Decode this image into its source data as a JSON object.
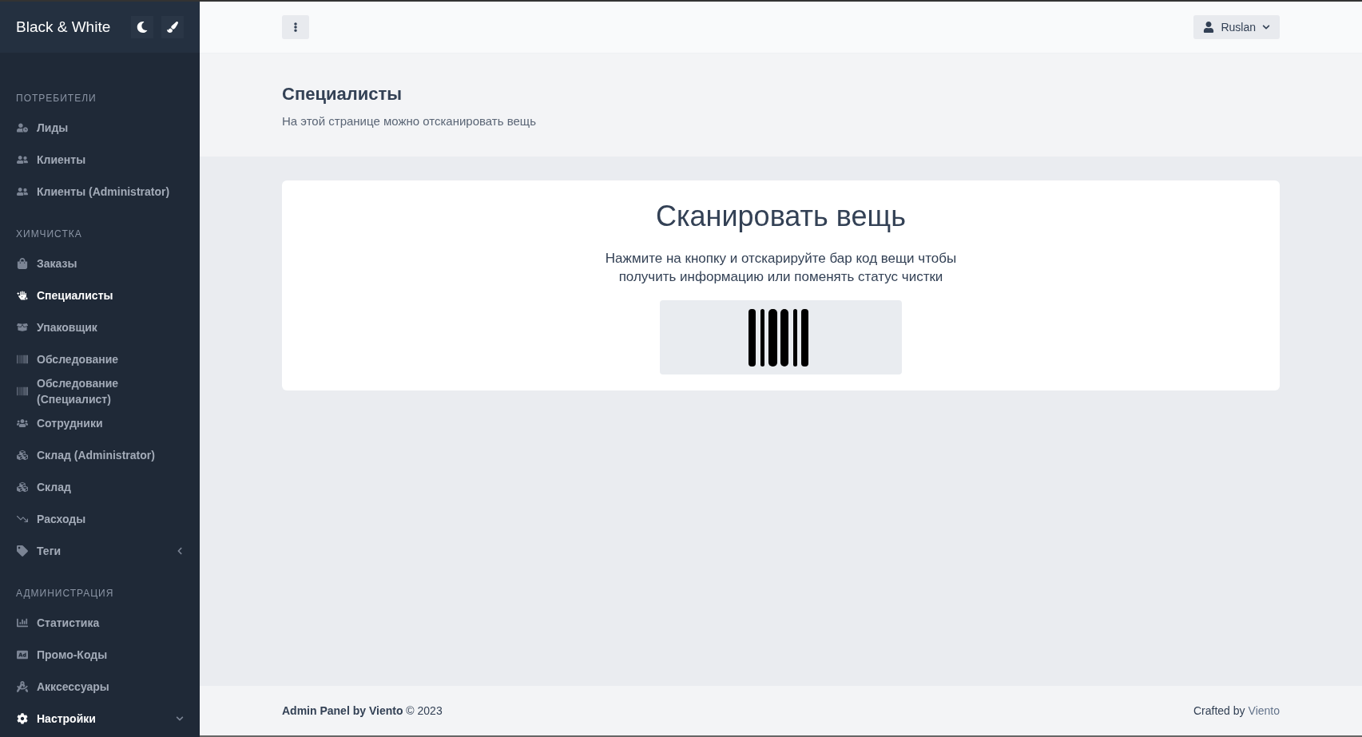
{
  "sidebar": {
    "brand": "Black & White",
    "sections": [
      {
        "title": "ПОТРЕБИТЕЛИ",
        "items": [
          {
            "label": "Лиды",
            "selected": false
          },
          {
            "label": "Клиенты",
            "selected": false
          },
          {
            "label": "Клиенты (Administrator)",
            "selected": false
          }
        ]
      },
      {
        "title": "ХИМЧИСТКА",
        "items": [
          {
            "label": "Заказы",
            "selected": false
          },
          {
            "label": "Специалисты",
            "selected": true
          },
          {
            "label": "Упаковщик",
            "selected": false
          },
          {
            "label": "Обследование",
            "selected": false
          },
          {
            "label": "Обследование (Специалист)",
            "selected": false
          },
          {
            "label": "Сотрудники",
            "selected": false
          },
          {
            "label": "Склад (Administrator)",
            "selected": false
          },
          {
            "label": "Склад",
            "selected": false
          },
          {
            "label": "Расходы",
            "selected": false
          },
          {
            "label": "Теги",
            "selected": false,
            "expanded": false
          }
        ]
      },
      {
        "title": "АДМИНИСТРАЦИЯ",
        "items": [
          {
            "label": "Статистика",
            "selected": false
          },
          {
            "label": "Промо-Коды",
            "selected": false
          },
          {
            "label": "Акксессуары",
            "selected": false
          },
          {
            "label": "Настройки",
            "selected": true,
            "expanded": true
          }
        ]
      }
    ]
  },
  "header": {
    "user": "Ruslan"
  },
  "page": {
    "title": "Специалисты",
    "subtitle": "На этой странице можно отсканировать вещь"
  },
  "card": {
    "title": "Сканировать вещь",
    "text": "Нажмите на кнопку и отскарируйте бар код вещи чтобы получить информацию или поменять статус чистки"
  },
  "footer": {
    "left": "**Admin Panel by Viento** © 2023",
    "credit": "Crafted by",
    "credit_link": "Viento"
  }
}
